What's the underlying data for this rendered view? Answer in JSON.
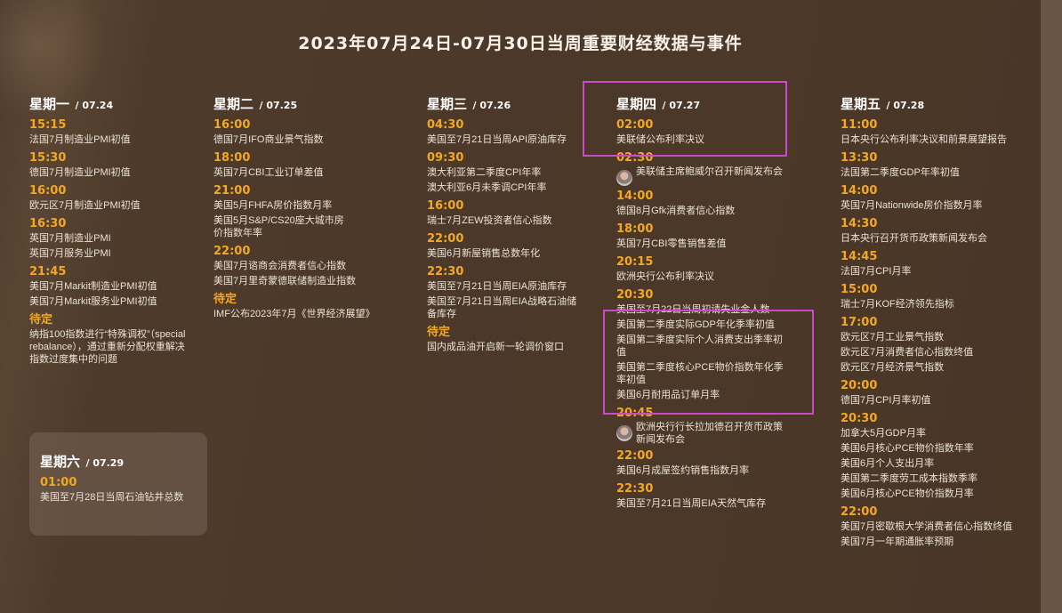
{
  "title": "2023年07月24日-07月30日当周重要财经数据与事件",
  "days": [
    {
      "name": "星期一",
      "date": "/ 07.24",
      "events": [
        {
          "time": "15:15",
          "items": [
            "法国7月制造业PMI初值"
          ]
        },
        {
          "time": "15:30",
          "items": [
            "德国7月制造业PMI初值"
          ]
        },
        {
          "time": "16:00",
          "items": [
            "欧元区7月制造业PMI初值"
          ]
        },
        {
          "time": "16:30",
          "items": [
            "英国7月制造业PMI",
            "英国7月服务业PMI"
          ]
        },
        {
          "time": "21:45",
          "items": [
            "美国7月Markit制造业PMI初值",
            "美国7月Markit服务业PMI初值"
          ]
        },
        {
          "time": "待定",
          "items": [
            "纳指100指数进行“特殊调权”（special rebalance），通过重新分配权重解决指数过度集中的问题"
          ]
        }
      ]
    },
    {
      "name": "星期二",
      "date": "/ 07.25",
      "events": [
        {
          "time": "16:00",
          "items": [
            "德国7月IFO商业景气指数"
          ]
        },
        {
          "time": "18:00",
          "items": [
            "英国7月CBI工业订单差值"
          ]
        },
        {
          "time": "21:00",
          "items": [
            "美国5月FHFA房价指数月率",
            "美国5月S&P/CS20座大城市房价指数年率"
          ]
        },
        {
          "time": "22:00",
          "items": [
            "美国7月谘商会消费者信心指数",
            "美国7月里奇蒙德联储制造业指数"
          ]
        },
        {
          "time": "待定",
          "items": [
            "IMF公布2023年7月《世界经济展望》"
          ]
        }
      ]
    },
    {
      "name": "星期三",
      "date": "/ 07.26",
      "events": [
        {
          "time": "04:30",
          "items": [
            "美国至7月21日当周API原油库存"
          ]
        },
        {
          "time": "09:30",
          "items": [
            "澳大利亚第二季度CPI年率",
            "澳大利亚6月未季调CPI年率"
          ]
        },
        {
          "time": "16:00",
          "items": [
            "瑞士7月ZEW投资者信心指数"
          ]
        },
        {
          "time": "22:00",
          "items": [
            "美国6月新屋销售总数年化"
          ]
        },
        {
          "time": "22:30",
          "items": [
            "美国至7月21日当周EIA原油库存",
            "美国至7月21日当周EIA战略石油储备库存"
          ]
        },
        {
          "time": "待定",
          "items": [
            "国内成品油开启新一轮调价窗口"
          ]
        }
      ]
    },
    {
      "name": "星期四",
      "date": "/ 07.27",
      "events": [
        {
          "time": "02:00",
          "items": [
            "美联储公布利率决议"
          ]
        },
        {
          "time": "02:30",
          "items": [
            "美联储主席鲍威尔召开新闻发布会"
          ]
        },
        {
          "time": "14:00",
          "items": [
            "德国8月Gfk消费者信心指数"
          ]
        },
        {
          "time": "18:00",
          "items": [
            "英国7月CBI零售销售差值"
          ]
        },
        {
          "time": "20:15",
          "items": [
            "欧洲央行公布利率决议"
          ]
        },
        {
          "time": "20:30",
          "items": [
            "美国至7月22日当周初请失业金人数",
            "美国第二季度实际GDP年化季率初值",
            "美国第二季度实际个人消费支出季率初值",
            "美国第二季度核心PCE物价指数年化季率初值",
            "美国6月耐用品订单月率"
          ]
        },
        {
          "time": "20:45",
          "items": [
            "欧洲央行行长拉加德召开货币政策新闻发布会"
          ]
        },
        {
          "time": "22:00",
          "items": [
            "美国6月成屋签约销售指数月率"
          ]
        },
        {
          "time": "22:30",
          "items": [
            "美国至7月21日当周EIA天然气库存"
          ]
        }
      ]
    },
    {
      "name": "星期五",
      "date": "/ 07.28",
      "events": [
        {
          "time": "11:00",
          "items": [
            "日本央行公布利率决议和前景展望报告"
          ]
        },
        {
          "time": "13:30",
          "items": [
            "法国第二季度GDP年率初值"
          ]
        },
        {
          "time": "14:00",
          "items": [
            "英国7月Nationwide房价指数月率"
          ]
        },
        {
          "time": "14:30",
          "items": [
            "日本央行召开货币政策新闻发布会"
          ]
        },
        {
          "time": "14:45",
          "items": [
            "法国7月CPI月率"
          ]
        },
        {
          "time": "15:00",
          "items": [
            "瑞士7月KOF经济领先指标"
          ]
        },
        {
          "time": "17:00",
          "items": [
            "欧元区7月工业景气指数",
            "欧元区7月消费者信心指数终值",
            "欧元区7月经济景气指数"
          ]
        },
        {
          "time": "20:00",
          "items": [
            "德国7月CPI月率初值"
          ]
        },
        {
          "time": "20:30",
          "items": [
            "加拿大5月GDP月率",
            "美国6月核心PCE物价指数年率",
            "美国6月个人支出月率",
            "美国第二季度劳工成本指数季率",
            "美国6月核心PCE物价指数月率"
          ]
        },
        {
          "time": "22:00",
          "items": [
            "美国7月密歇根大学消费者信心指数终值",
            "美国7月一年期通胀率预期"
          ]
        }
      ]
    },
    {
      "name": "星期六",
      "date": "/ 07.29",
      "events": [
        {
          "time": "01:00",
          "items": [
            "美国至7月28日当周石油钻井总数"
          ]
        }
      ]
    }
  ],
  "highlight_color": "#c94bc9"
}
